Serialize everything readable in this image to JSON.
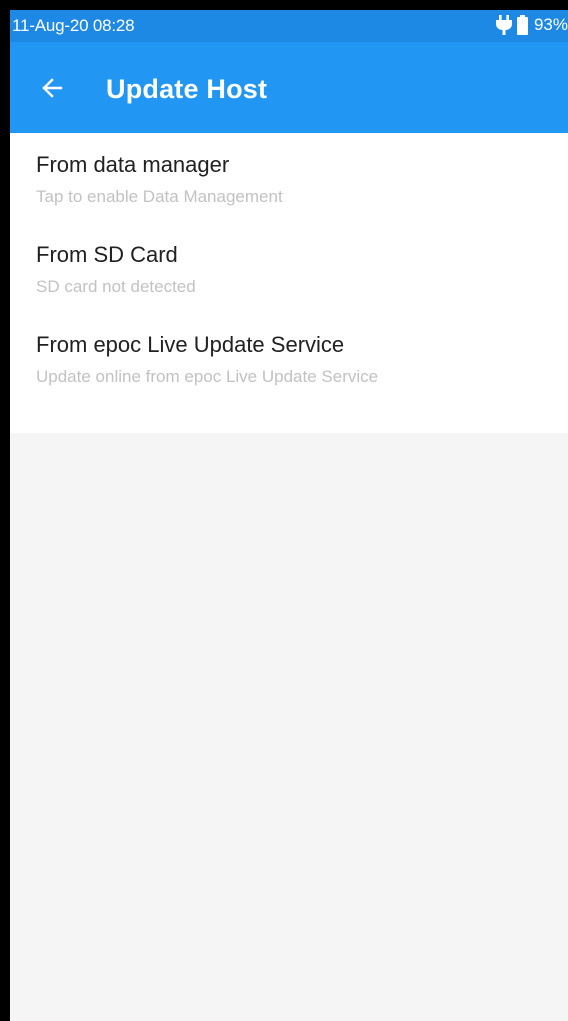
{
  "status_bar": {
    "time": "11-Aug-20 08:28",
    "battery_percent": "93%",
    "icons": [
      "charging-plug-icon",
      "battery-icon"
    ]
  },
  "app_bar": {
    "back_icon": "arrow-left-icon",
    "title": "Update Host"
  },
  "list": {
    "items": [
      {
        "title": "From data manager",
        "summary": "Tap to enable Data Management"
      },
      {
        "title": "From SD Card",
        "summary": "SD card not detected"
      },
      {
        "title": "From epoc Live Update Service",
        "summary": "Update online from epoc Live Update Service"
      }
    ]
  },
  "colors": {
    "status_bar": "#1e88e5",
    "app_bar": "#2196f3",
    "item_title": "#212121",
    "item_summary": "#c2c2c2",
    "background": "#f5f5f5",
    "list_background": "#ffffff"
  }
}
